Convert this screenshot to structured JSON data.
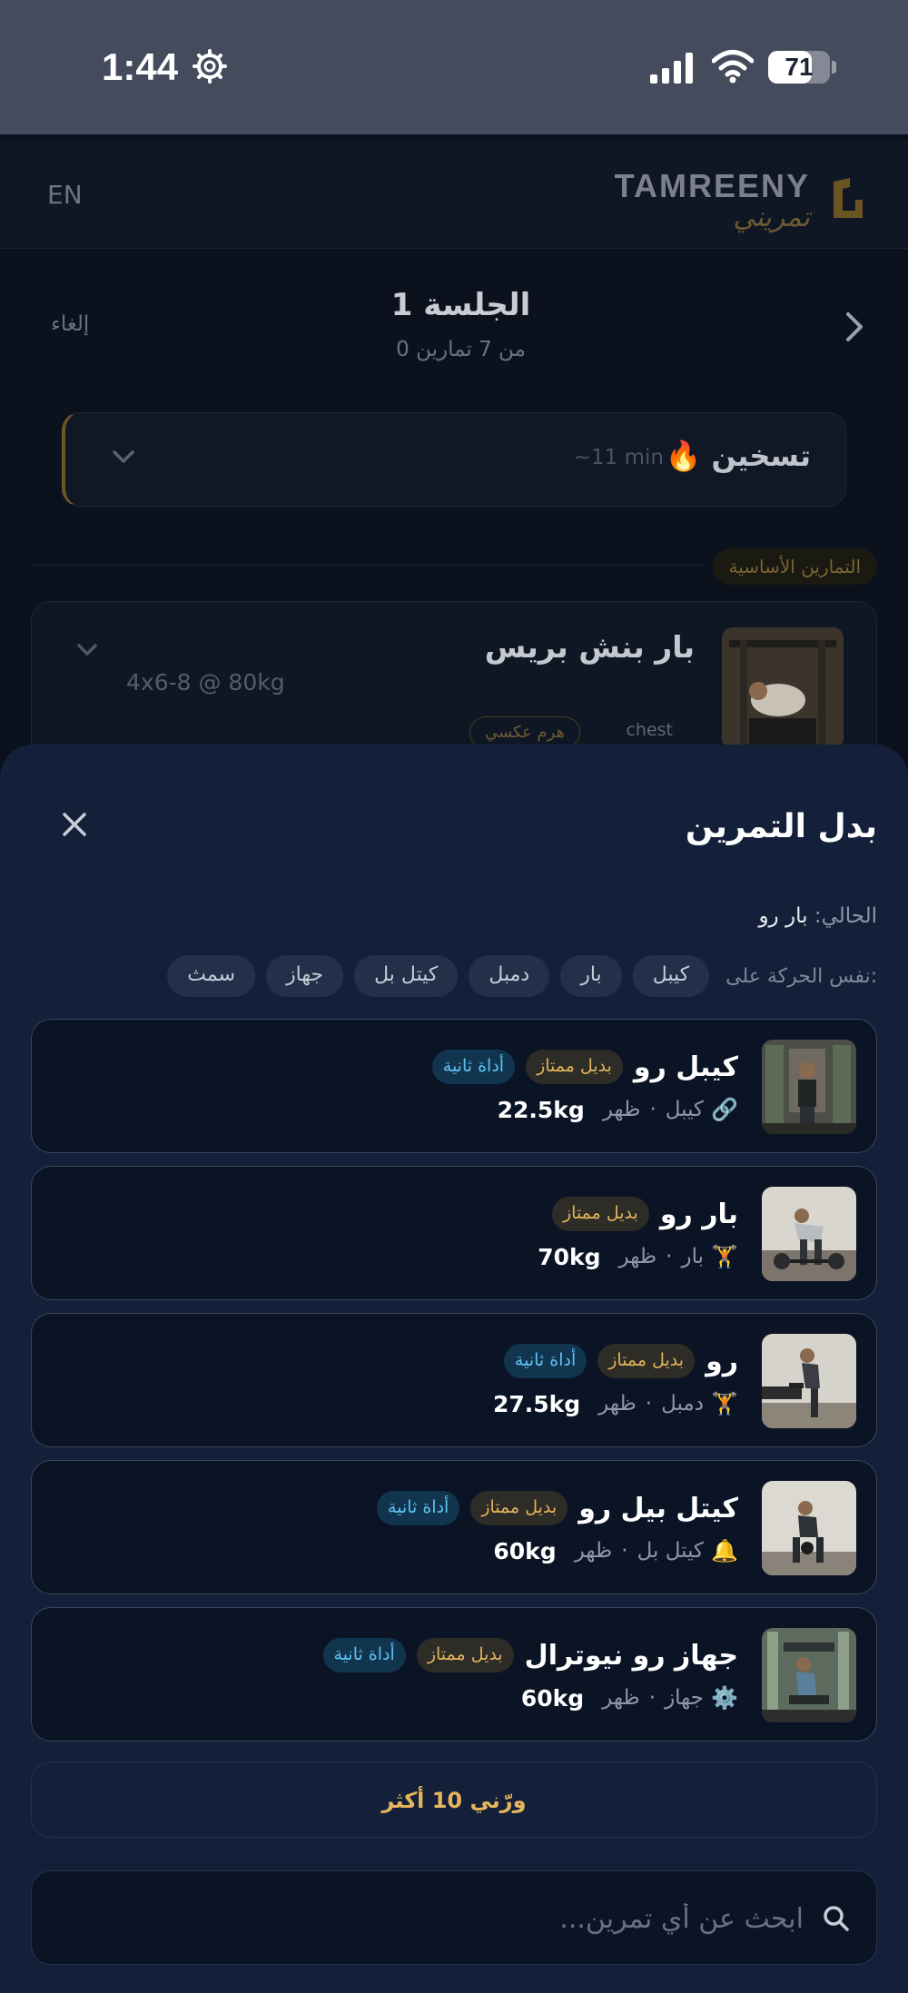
{
  "status_bar": {
    "time": "1:44",
    "battery": "71",
    "battery_level": 0.71
  },
  "app": {
    "language_toggle": "EN",
    "logo_en": "TAMREENY",
    "logo_ar": "تمريني"
  },
  "session": {
    "title": "الجلسة 1",
    "subtitle": "0 من 7 تمارين",
    "cancel_label": "إلغاء"
  },
  "warmup": {
    "icon": "fire-icon",
    "title": "🔥 تسخين",
    "duration": "~11 min"
  },
  "section_label": "التمارين الأساسية",
  "exercise": {
    "name": "بار بنش بريس",
    "sets": "4x6-8 @ 80kg",
    "muscle_tag": "chest",
    "variation_tag": "هرم عكسي"
  },
  "sheet": {
    "title": "بدل التمرين",
    "current_label": "الحالي:",
    "current_value": "بار رو",
    "same_movement_label": "نفس الحركة على:",
    "filters": [
      "كيبل",
      "بار",
      "دمبل",
      "كيتل بل",
      "جهاز",
      "سمث"
    ],
    "alternatives": [
      {
        "name": "كيبل رو",
        "badge_gold": "بديل ممتاز",
        "badge_blue": "أداة ثانية",
        "icon": "🔗",
        "equipment": "كيبل",
        "muscle": "ظهر",
        "weight": "22.5kg"
      },
      {
        "name": "بار رو",
        "badge_gold": "بديل ممتاز",
        "badge_blue": "",
        "icon": "🏋️",
        "equipment": "بار",
        "muscle": "ظهر",
        "weight": "70kg"
      },
      {
        "name": "رو",
        "badge_gold": "بديل ممتاز",
        "badge_blue": "أداة ثانية",
        "icon": "🏋",
        "equipment": "دمبل",
        "muscle": "ظهر",
        "weight": "27.5kg"
      },
      {
        "name": "كيتل بيل رو",
        "badge_gold": "بديل ممتاز",
        "badge_blue": "أداة ثانية",
        "icon": "🔔",
        "equipment": "كيتل بل",
        "muscle": "ظهر",
        "weight": "60kg"
      },
      {
        "name": "جهاز رو نيوترال",
        "badge_gold": "بديل ممتاز",
        "badge_blue": "أداة ثانية",
        "icon": "⚙️",
        "equipment": "جهاز",
        "muscle": "ظهر",
        "weight": "60kg"
      }
    ],
    "separator": "·",
    "more_label": "ورّني 10 أكثر",
    "search_placeholder": "ابحث عن أي تمرين..."
  }
}
